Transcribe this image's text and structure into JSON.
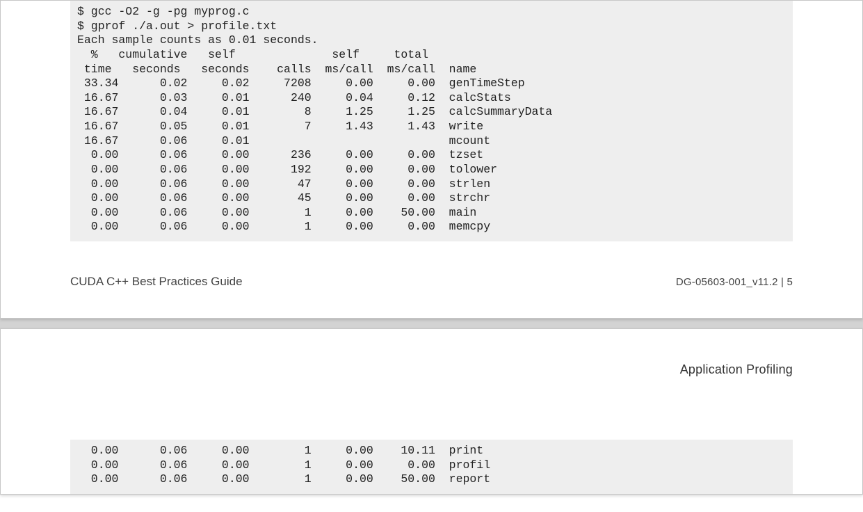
{
  "page1": {
    "code_lines": [
      "$ gcc -O2 -g -pg myprog.c",
      "$ gprof ./a.out > profile.txt",
      "Each sample counts as 0.01 seconds.",
      "  %   cumulative   self              self     total",
      " time   seconds   seconds    calls  ms/call  ms/call  name",
      " 33.34      0.02     0.02     7208     0.00     0.00  genTimeStep",
      " 16.67      0.03     0.01      240     0.04     0.12  calcStats",
      " 16.67      0.04     0.01        8     1.25     1.25  calcSummaryData",
      " 16.67      0.05     0.01        7     1.43     1.43  write",
      " 16.67      0.06     0.01                             mcount",
      "  0.00      0.06     0.00      236     0.00     0.00  tzset",
      "  0.00      0.06     0.00      192     0.00     0.00  tolower",
      "  0.00      0.06     0.00       47     0.00     0.00  strlen",
      "  0.00      0.06     0.00       45     0.00     0.00  strchr",
      "  0.00      0.06     0.00        1     0.00    50.00  main",
      "  0.00      0.06     0.00        1     0.00     0.00  memcpy"
    ],
    "footer_left": "CUDA C++ Best Practices Guide",
    "footer_right": "DG-05603-001_v11.2   |   5"
  },
  "page2": {
    "header_right": "Application Profiling",
    "code_lines": [
      "  0.00      0.06     0.00        1     0.00    10.11  print",
      "  0.00      0.06     0.00        1     0.00     0.00  profil",
      "  0.00      0.06     0.00        1     0.00    50.00  report"
    ]
  }
}
